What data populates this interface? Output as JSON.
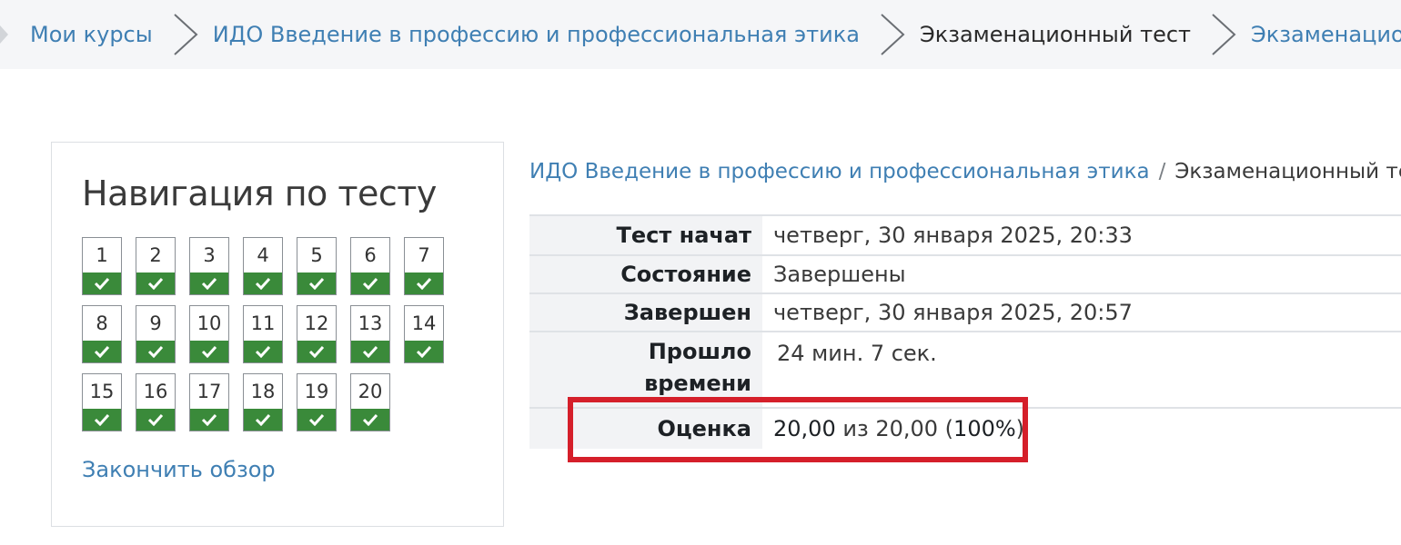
{
  "breadcrumb": {
    "items": [
      {
        "label": "Мои курсы",
        "current": false
      },
      {
        "label": "ИДО Введение в профессию и профессиональная этика",
        "current": false
      },
      {
        "label": "Экзаменационный тест",
        "current": true
      },
      {
        "label": "Экзаменационный тест",
        "current": false
      }
    ]
  },
  "quiz_nav": {
    "title": "Навигация по тесту",
    "questions": [
      {
        "number": "1",
        "status": "answered"
      },
      {
        "number": "2",
        "status": "answered"
      },
      {
        "number": "3",
        "status": "answered"
      },
      {
        "number": "4",
        "status": "answered"
      },
      {
        "number": "5",
        "status": "answered"
      },
      {
        "number": "6",
        "status": "answered"
      },
      {
        "number": "7",
        "status": "answered"
      },
      {
        "number": "8",
        "status": "answered"
      },
      {
        "number": "9",
        "status": "answered"
      },
      {
        "number": "10",
        "status": "answered"
      },
      {
        "number": "11",
        "status": "answered"
      },
      {
        "number": "12",
        "status": "answered"
      },
      {
        "number": "13",
        "status": "answered"
      },
      {
        "number": "14",
        "status": "answered"
      },
      {
        "number": "15",
        "status": "answered"
      },
      {
        "number": "16",
        "status": "answered"
      },
      {
        "number": "17",
        "status": "answered"
      },
      {
        "number": "18",
        "status": "answered"
      },
      {
        "number": "19",
        "status": "answered"
      },
      {
        "number": "20",
        "status": "answered"
      }
    ],
    "status_icon": "check-icon",
    "status_color": "#3a8a3a",
    "finish_label": "Закончить обзор"
  },
  "summary": {
    "crumb_course": "ИДО Введение в профессию и профессиональная этика",
    "crumb_separator": "/",
    "crumb_current": "Экзаменационный тест",
    "started_label": "Тест начат",
    "started_value": "четверг, 30 января 2025, 20:33",
    "state_label": "Состояние",
    "state_value": "Завершены",
    "completed_label": "Завершен",
    "completed_value": "четверг, 30 января 2025, 20:57",
    "elapsed_label_line1": "Прошло",
    "elapsed_label_line2": "времени",
    "elapsed_value": "24 мин. 7 сек.",
    "grade_label": "Оценка",
    "grade_score": "20,00",
    "grade_of": "из 20,00 (",
    "grade_percent": "100%",
    "grade_close": ")"
  },
  "colors": {
    "link": "#3f7fb3",
    "highlight": "#d51f2a"
  }
}
